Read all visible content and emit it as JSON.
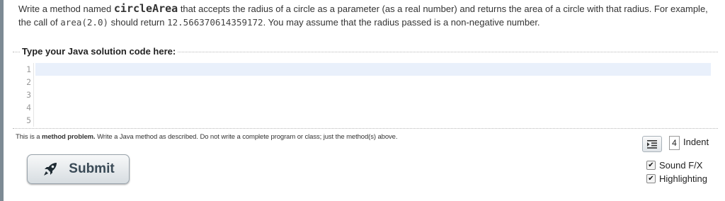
{
  "prompt": {
    "part1": "Write a method named ",
    "method_name": "circleArea",
    "part2": " that accepts the radius of a circle as a parameter (as a real number) and returns the area of a circle with that radius. For example, the call of ",
    "example_call": "area(2.0)",
    "part3": " should return ",
    "example_result": "12.566370614359172",
    "part4": ". You may assume that the radius passed is a non-negative number."
  },
  "editor": {
    "legend": "Type your Java solution code here:",
    "line_numbers": [
      "1",
      "2",
      "3",
      "4",
      "5"
    ]
  },
  "note": {
    "prefix": "This is a ",
    "bold": "method problem.",
    "rest": " Write a Java method as described. Do not write a complete program or class; just the method(s) above."
  },
  "submit": {
    "label": "Submit",
    "icon": "rocket-icon"
  },
  "indent": {
    "value": "4",
    "label": "Indent",
    "icon": "indent-icon"
  },
  "options": [
    {
      "label": "Sound F/X",
      "checked": true
    },
    {
      "label": "Highlighting",
      "checked": true
    }
  ],
  "colors": {
    "active_line": "#e9f0fb",
    "button_text": "#3a4a56",
    "rule": "#7d8a94"
  }
}
